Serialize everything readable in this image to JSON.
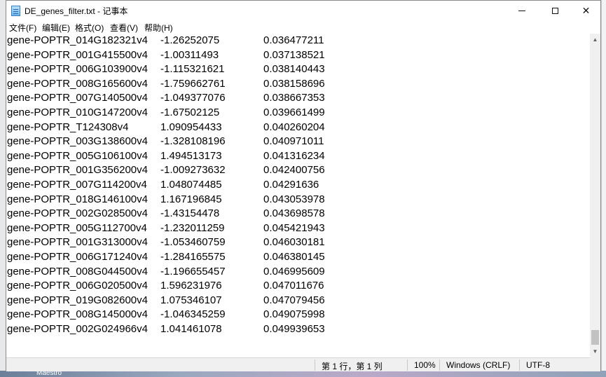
{
  "window": {
    "title": "DE_genes_filter.txt - 记事本"
  },
  "menu": [
    "文件(F)",
    "编辑(E)",
    "格式(O)",
    "查看(V)",
    "帮助(H)"
  ],
  "rows": [
    [
      "gene-POPTR_014G182321v4",
      "-1.26252075",
      "0.036477211"
    ],
    [
      "gene-POPTR_001G415500v4",
      "-1.00311493",
      "0.037138521"
    ],
    [
      "gene-POPTR_006G103900v4",
      "-1.115321621",
      "0.038140443"
    ],
    [
      "gene-POPTR_008G165600v4",
      "-1.759662761",
      "0.038158696"
    ],
    [
      "gene-POPTR_007G140500v4",
      "-1.049377076",
      "0.038667353"
    ],
    [
      "gene-POPTR_010G147200v4",
      "-1.67502125",
      "0.039661499"
    ],
    [
      "gene-POPTR_T124308v4",
      "1.090954433",
      "0.040260204"
    ],
    [
      "gene-POPTR_003G138600v4",
      "-1.328108196",
      "0.040971011"
    ],
    [
      "gene-POPTR_005G106100v4",
      "1.494513173",
      "0.041316234"
    ],
    [
      "gene-POPTR_001G356200v4",
      "-1.009273632",
      "0.042400756"
    ],
    [
      "gene-POPTR_007G114200v4",
      "1.048074485",
      "0.04291636"
    ],
    [
      "gene-POPTR_018G146100v4",
      "1.167196845",
      "0.043053978"
    ],
    [
      "gene-POPTR_002G028500v4",
      "-1.43154478",
      "0.043698578"
    ],
    [
      "gene-POPTR_005G112700v4",
      "-1.232011259",
      "0.045421943"
    ],
    [
      "gene-POPTR_001G313000v4",
      "-1.053460759",
      "0.046030181"
    ],
    [
      "gene-POPTR_006G171240v4",
      "-1.284165575",
      "0.046380145"
    ],
    [
      "gene-POPTR_008G044500v4",
      "-1.196655457",
      "0.046995609"
    ],
    [
      "gene-POPTR_006G020500v4",
      "1.596231976",
      "0.047011676"
    ],
    [
      "gene-POPTR_019G082600v4",
      "1.075346107",
      "0.047079456"
    ],
    [
      "gene-POPTR_008G145000v4",
      "-1.046345259",
      "0.049075998"
    ],
    [
      "gene-POPTR_002G024966v4",
      "1.041461078",
      "0.049939653"
    ]
  ],
  "status": {
    "position": "第 1 行，第 1 列",
    "zoom": "100%",
    "line_ending": "Windows (CRLF)",
    "encoding": "UTF-8"
  },
  "taskbar": {
    "label": "Maestro"
  },
  "icons": {
    "app": "notepad-icon",
    "minimize": "minimize-icon",
    "maximize": "maximize-icon",
    "close": "close-icon"
  }
}
